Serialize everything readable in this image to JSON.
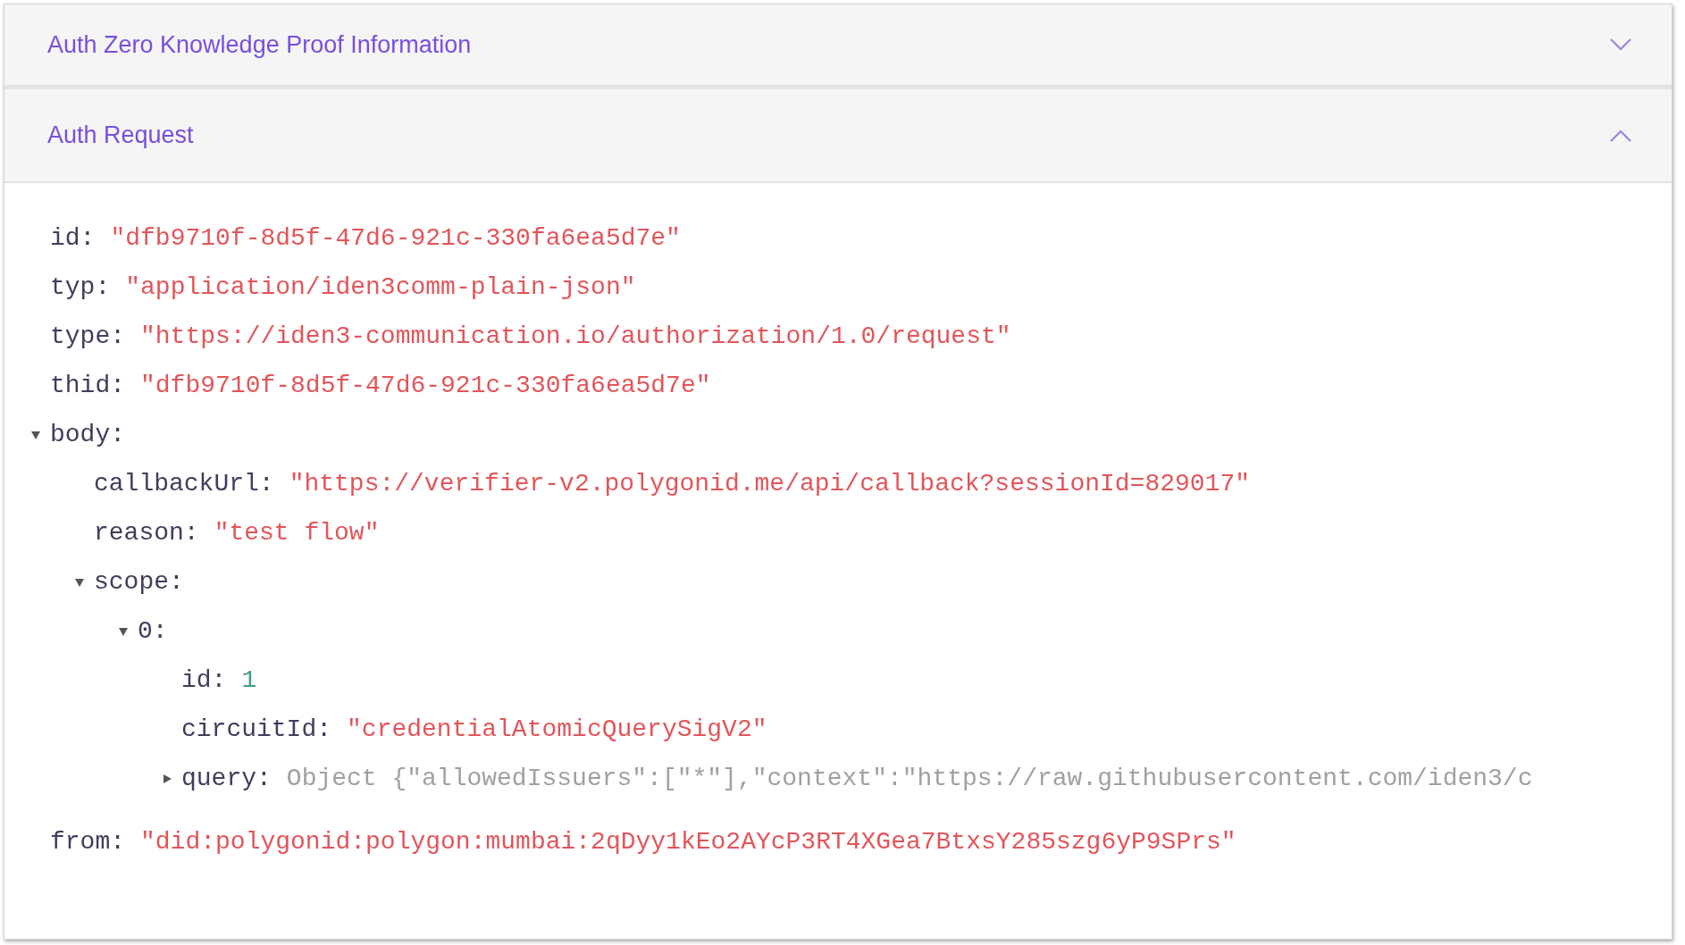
{
  "accordion": [
    {
      "title": "Auth Zero Knowledge Proof Information",
      "expanded": false
    },
    {
      "title": "Auth Request",
      "expanded": true,
      "tree": [
        {
          "key": "id:",
          "kind": "string",
          "value": "\"dfb9710f-8d5f-47d6-921c-330fa6ea5d7e\""
        },
        {
          "key": "typ:",
          "kind": "string",
          "value": "\"application/iden3comm-plain-json\""
        },
        {
          "key": "type:",
          "kind": "string",
          "value": "\"https://iden3-communication.io/authorization/1.0/request\""
        },
        {
          "key": "thid:",
          "kind": "string",
          "value": "\"dfb9710f-8d5f-47d6-921c-330fa6ea5d7e\""
        },
        {
          "key": "body:",
          "kind": "object",
          "expanded": true,
          "children": [
            {
              "key": "callbackUrl:",
              "kind": "string",
              "value": "\"https://verifier-v2.polygonid.me/api/callback?sessionId=829017\""
            },
            {
              "key": "reason:",
              "kind": "string",
              "value": "\"test flow\""
            },
            {
              "key": "scope:",
              "kind": "object",
              "expanded": true,
              "children": [
                {
                  "key": "0:",
                  "kind": "object",
                  "expanded": true,
                  "children": [
                    {
                      "key": "id:",
                      "kind": "number",
                      "value": "1"
                    },
                    {
                      "key": "circuitId:",
                      "kind": "string",
                      "value": "\"credentialAtomicQuerySigV2\""
                    },
                    {
                      "key": "query:",
                      "kind": "object",
                      "expanded": false,
                      "value": "Object {\"allowedIssuers\":[\"*\"],\"context\":\"https://raw.githubusercontent.com/iden3/c"
                    }
                  ]
                }
              ]
            }
          ]
        },
        {
          "key": "from:",
          "kind": "string",
          "value": "\"did:polygonid:polygon:mumbai:2qDyy1kEo2AYcP3RT4XGea7BtxsY285szg6yP9SPrs\""
        }
      ]
    }
  ]
}
